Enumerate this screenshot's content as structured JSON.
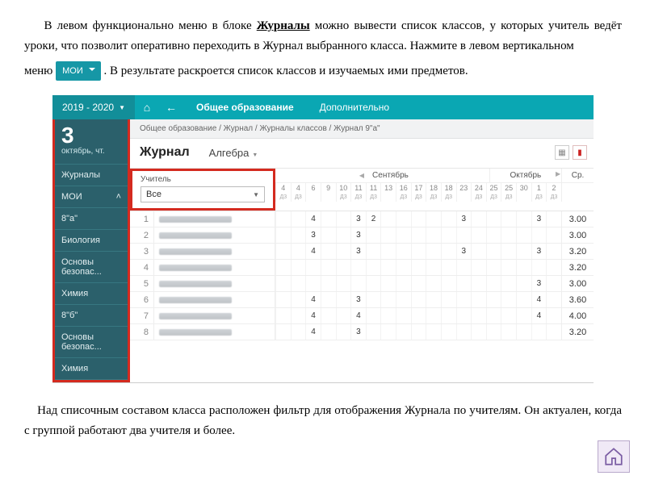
{
  "intro": {
    "p1a": "В левом функционально меню в блоке ",
    "p1b": "Журналы",
    "p1c": " можно вывести список классов, у которых учитель ведёт уроки, что позволит оперативно переходить в Журнал выбранного класса. Нажмите  в левом вертикальном",
    "p2a": "меню ",
    "p2b": ". В результате раскроется список классов и изучаемых ими предметов.",
    "moi_label": "МОИ"
  },
  "outro": "Над списочным составом класса расположен фильтр для отображения Журнала по учителям. Он актуален, когда с группой работают два учителя и более.",
  "topbar": {
    "year": "2019 - 2020",
    "tab1": "Общее образование",
    "tab2": "Дополнительно"
  },
  "sidebar": {
    "day": "3",
    "weekday": "октябрь, чт.",
    "items": [
      "Журналы",
      "МОИ",
      "8\"а\"",
      "Биология",
      "Основы безопас...",
      "Химия",
      "8\"б\"",
      "Основы безопас...",
      "Химия"
    ]
  },
  "crumbs": "Общее образование / Журнал / Журналы классов / Журнал 9\"а\"",
  "title": {
    "journal": "Журнал",
    "subject": "Алгебра"
  },
  "teacher": {
    "label": "Учитель",
    "value": "Все"
  },
  "months": {
    "m1": "Сентябрь",
    "m2": "Октябрь",
    "avg": "Ср."
  },
  "days": {
    "nums": [
      "4",
      "4",
      "6",
      "9",
      "10",
      "11",
      "11",
      "13",
      "16",
      "17",
      "18",
      "18",
      "23",
      "24",
      "25",
      "25",
      "30",
      "1",
      "2"
    ],
    "dz": [
      "Д3",
      "Д3",
      "",
      "",
      "Д3",
      "Д3",
      "Д3",
      "",
      "Д3",
      "Д3",
      "Д3",
      "Д3",
      "",
      "Д3",
      "Д3",
      "Д3",
      "",
      "Д3",
      "Д3"
    ]
  },
  "rows": [
    {
      "n": "1",
      "marks": {
        "2": "4",
        "5": "3",
        "6": "2",
        "12": "3",
        "17": "3"
      },
      "avg": "3.00"
    },
    {
      "n": "2",
      "marks": {
        "2": "3",
        "5": "3"
      },
      "avg": "3.00"
    },
    {
      "n": "3",
      "marks": {
        "2": "4",
        "5": "3",
        "12": "3",
        "17": "3"
      },
      "avg": "3.20"
    },
    {
      "n": "4",
      "marks": {},
      "avg": "3.20"
    },
    {
      "n": "5",
      "marks": {
        "17": "3"
      },
      "avg": "3.00"
    },
    {
      "n": "6",
      "marks": {
        "2": "4",
        "5": "3",
        "17": "4"
      },
      "avg": "3.60"
    },
    {
      "n": "7",
      "marks": {
        "2": "4",
        "5": "4",
        "17": "4"
      },
      "avg": "4.00"
    },
    {
      "n": "8",
      "marks": {
        "2": "4",
        "5": "3"
      },
      "avg": "3.20"
    }
  ]
}
